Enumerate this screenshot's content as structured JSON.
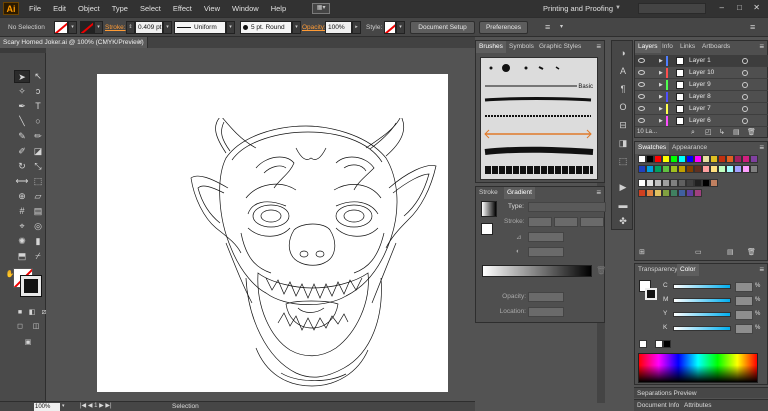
{
  "menubar": {
    "logo": "Ai",
    "items": [
      "File",
      "Edit",
      "Object",
      "Type",
      "Select",
      "Effect",
      "View",
      "Window",
      "Help"
    ],
    "workspace": "Printing and Proofing",
    "window_controls": [
      "–",
      "□",
      "✕"
    ]
  },
  "controlbar": {
    "selection": "No Selection",
    "stroke_label": "Stroke:",
    "stroke_weight": "0.409 pt",
    "profile": "Uniform",
    "brush": "5 pt. Round",
    "opacity_label": "Opacity:",
    "opacity_value": "100%",
    "style_label": "Style:",
    "document_setup": "Document Setup",
    "preferences": "Preferences"
  },
  "document": {
    "tab_title": "Scary Horned Joker.ai @ 100% (CMYK/Preview)",
    "close": "✕"
  },
  "statusbar": {
    "zoom": "100%",
    "mode": "Selection"
  },
  "brushes_panel": {
    "tabs": [
      "Brushes",
      "Symbols",
      "Graphic Styles"
    ],
    "basic_label": "Basic"
  },
  "gradient_panel": {
    "tabs": [
      "Stroke",
      "Gradient"
    ],
    "type_label": "Type:",
    "stroke_label": "Stroke:",
    "opacity_label": "Opacity:",
    "location_label": "Location:"
  },
  "layers_panel": {
    "tabs": [
      "Layers",
      "Info",
      "Links",
      "Artboards"
    ],
    "layers": [
      {
        "name": "Layer 1",
        "color": "#4f7fff",
        "selected": true
      },
      {
        "name": "Layer 10",
        "color": "#ff4f4f",
        "selected": false
      },
      {
        "name": "Layer 9",
        "color": "#4fff4f",
        "selected": false
      },
      {
        "name": "Layer 8",
        "color": "#4f4fff",
        "selected": false
      },
      {
        "name": "Layer 7",
        "color": "#ffff4f",
        "selected": false
      },
      {
        "name": "Layer 6",
        "color": "#ff4fff",
        "selected": false
      }
    ],
    "count": "10 La..."
  },
  "swatches_panel": {
    "tabs": [
      "Swatches",
      "Appearance"
    ]
  },
  "color_panel": {
    "tabs": [
      "Transparency",
      "Color"
    ],
    "channels": [
      {
        "label": "C",
        "value": ""
      },
      {
        "label": "M",
        "value": ""
      },
      {
        "label": "Y",
        "value": ""
      },
      {
        "label": "K",
        "value": ""
      }
    ],
    "percent": "%"
  },
  "bottom_panels": {
    "separations": "Separations Preview",
    "docinfo_tabs": [
      "Document Info",
      "Attributes"
    ]
  }
}
